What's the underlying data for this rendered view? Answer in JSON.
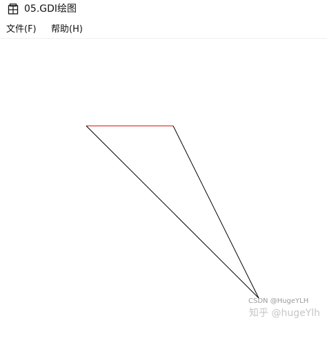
{
  "window": {
    "title": "05.GDI绘图",
    "icon": "app-window-icon"
  },
  "menu": {
    "items": [
      {
        "label": "文件(F)"
      },
      {
        "label": "帮助(H)"
      }
    ]
  },
  "canvas": {
    "shapes": [
      {
        "kind": "line",
        "name": "red-line",
        "color": "#e00000"
      },
      {
        "kind": "line",
        "name": "black-line-1",
        "color": "#000000"
      },
      {
        "kind": "line",
        "name": "black-line-2",
        "color": "#000000"
      }
    ]
  },
  "watermark": {
    "primary": "知乎 @hugeYlh",
    "secondary": "CSDN @HugeYLH"
  }
}
